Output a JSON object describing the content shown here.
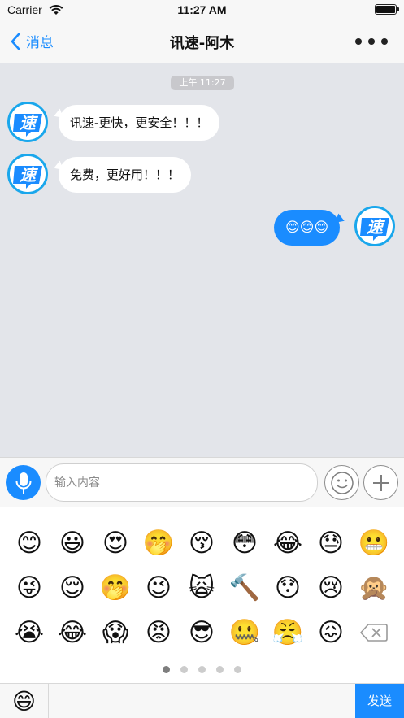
{
  "status_bar": {
    "carrier": "Carrier",
    "time": "11:27 AM"
  },
  "nav": {
    "back_label": "消息",
    "title": "讯速-阿木"
  },
  "chat": {
    "timestamp": "上午 11:27",
    "messages": [
      {
        "side": "left",
        "text": "讯速-更快，更安全！！！"
      },
      {
        "side": "left",
        "text": "免费，更好用！！！"
      },
      {
        "side": "right",
        "text": "😊😊😊"
      }
    ],
    "avatar_text": "速"
  },
  "input": {
    "placeholder": "输入内容"
  },
  "emoji_panel": {
    "rows": [
      [
        "😊",
        "😃",
        "😍",
        "🤭",
        "😚",
        "😳",
        "😂",
        "😓",
        "😬"
      ],
      [
        "😜",
        "😌",
        "🤭",
        "😉",
        "🙀",
        "🔨",
        "😯",
        "😢",
        "🙊"
      ],
      [
        "😭",
        "😂",
        "😱",
        "😡",
        "😎",
        "🤐",
        "😤",
        "😖"
      ]
    ],
    "pages": 5,
    "active_page": 1
  },
  "bottom": {
    "emoji_button": "😄",
    "send_label": "发送"
  }
}
